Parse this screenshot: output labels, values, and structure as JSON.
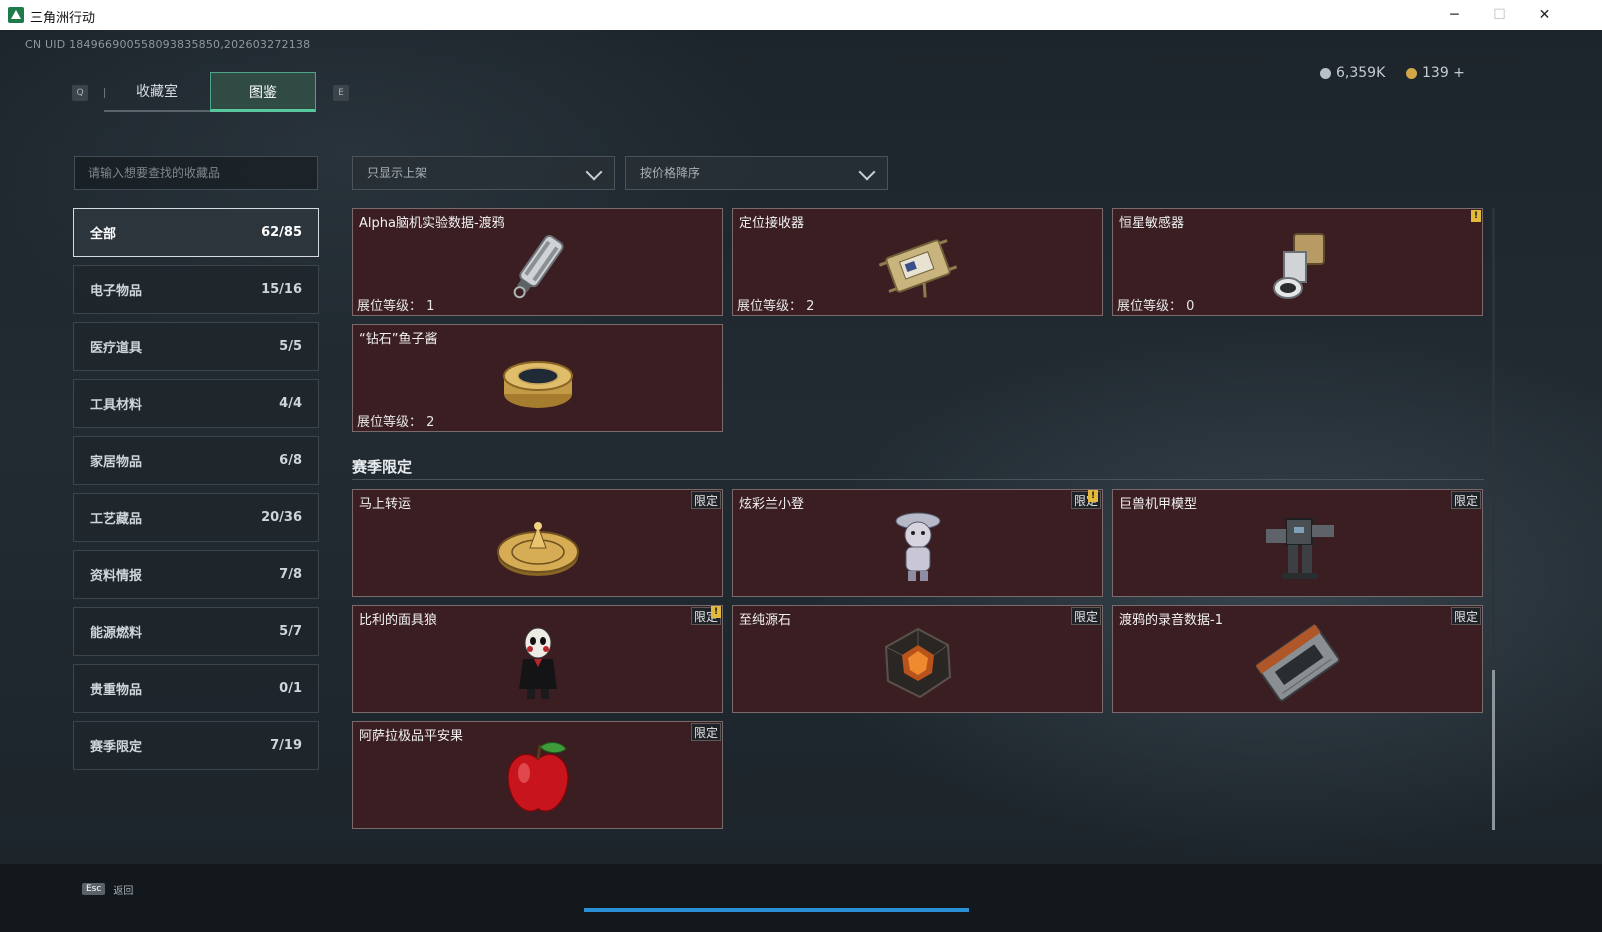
{
  "window": {
    "title": "三角洲行动",
    "minimize": "─",
    "maximize": "☐",
    "close": "✕"
  },
  "uid": "CN UID 184966900558093835850,202603272138",
  "keys": {
    "prev": "Q",
    "next": "E",
    "esc": "Esc"
  },
  "tabs": [
    {
      "label": "收藏室"
    },
    {
      "label": "图鉴",
      "active": true
    }
  ],
  "currency": [
    {
      "icon": "silver-coin-icon",
      "value": "6,359K",
      "color": "#b7c0c7"
    },
    {
      "icon": "gold-coin-icon",
      "value": "139 +",
      "color": "#d4a64a"
    }
  ],
  "search": {
    "placeholder": "请输入想要查找的收藏品"
  },
  "filters": {
    "shelf": "只显示上架",
    "sort": "按价格降序"
  },
  "categories": [
    {
      "label": "全部",
      "count": "62/85",
      "active": true
    },
    {
      "label": "电子物品",
      "count": "15/16"
    },
    {
      "label": "医疗道具",
      "count": "5/5"
    },
    {
      "label": "工具材料",
      "count": "4/4"
    },
    {
      "label": "家居物品",
      "count": "6/8"
    },
    {
      "label": "工艺藏品",
      "count": "20/36"
    },
    {
      "label": "资料情报",
      "count": "7/8"
    },
    {
      "label": "能源燃料",
      "count": "5/7"
    },
    {
      "label": "贵重物品",
      "count": "0/1"
    },
    {
      "label": "赛季限定",
      "count": "7/19"
    }
  ],
  "items": [
    {
      "name": "Alpha脑机实验数据-渡鸦",
      "level": "展位等级： 1",
      "icon": "data-canister-icon"
    },
    {
      "name": "定位接收器",
      "level": "展位等级： 2",
      "icon": "receiver-device-icon"
    },
    {
      "name": "恒星敏感器",
      "level": "展位等级： 0",
      "icon": "star-sensor-icon",
      "warning": "!"
    },
    {
      "name": "“钻石”鱼子酱",
      "level": "展位等级： 2",
      "icon": "caviar-tin-icon"
    }
  ],
  "season": {
    "title": "赛季限定",
    "tag": "限定",
    "items": [
      {
        "name": "马上转运",
        "icon": "horse-wheel-icon"
      },
      {
        "name": "炫彩兰小登",
        "icon": "figurine-icon",
        "warning": "!"
      },
      {
        "name": "巨兽机甲模型",
        "icon": "mech-model-icon"
      },
      {
        "name": "比利的面具狼",
        "icon": "puppet-doll-icon",
        "warning": "!"
      },
      {
        "name": "至纯源石",
        "icon": "source-stone-icon"
      },
      {
        "name": "渡鸦的录音数据-1",
        "icon": "tape-cassette-icon"
      },
      {
        "name": "阿萨拉极品平安果",
        "icon": "apple-icon"
      }
    ]
  },
  "footer": {
    "back": "返回"
  },
  "colors": {
    "accent": "#57c79d",
    "card_bg": "#3b1e22",
    "warning": "#e2b93b",
    "progress": "#2a8fd6"
  }
}
